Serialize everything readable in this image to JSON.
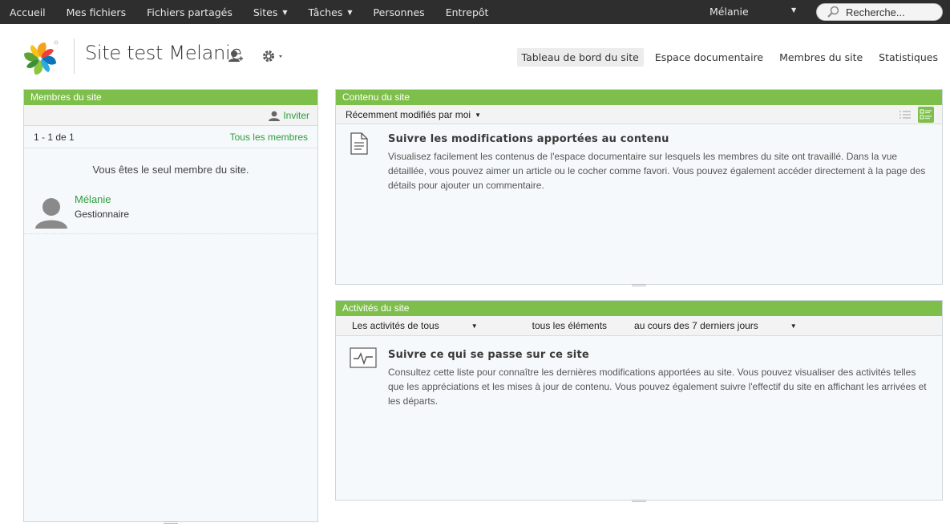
{
  "topnav": {
    "items": [
      {
        "label": "Accueil",
        "dropdown": false
      },
      {
        "label": "Mes fichiers",
        "dropdown": false
      },
      {
        "label": "Fichiers partagés",
        "dropdown": false
      },
      {
        "label": "Sites",
        "dropdown": true
      },
      {
        "label": "Tâches",
        "dropdown": true
      },
      {
        "label": "Personnes",
        "dropdown": false
      },
      {
        "label": "Entrepôt",
        "dropdown": false
      }
    ],
    "user": "Mélanie",
    "search_placeholder": "Recherche..."
  },
  "header": {
    "site_title": "Site test Melanie",
    "nav": [
      {
        "label": "Tableau de bord du site",
        "active": true
      },
      {
        "label": "Espace documentaire",
        "active": false
      },
      {
        "label": "Membres du site",
        "active": false
      },
      {
        "label": "Statistiques",
        "active": false
      }
    ]
  },
  "members_dashlet": {
    "title": "Membres du site",
    "invite": "Inviter",
    "count": "1 - 1 de 1",
    "all_members": "Tous les membres",
    "only_member": "Vous êtes le seul membre du site.",
    "members": [
      {
        "name": "Mélanie",
        "role": "Gestionnaire"
      }
    ]
  },
  "content_dashlet": {
    "title": "Contenu du site",
    "filter": "Récemment modifiés par moi",
    "help_title": "Suivre les modifications apportées au contenu",
    "help_text": "Visualisez facilement les contenus de l'espace documentaire sur lesquels les membres du site ont travaillé. Dans la vue détaillée, vous pouvez aimer un article ou le cocher comme favori. Vous pouvez également accéder directement à la page des détails pour ajouter un commentaire."
  },
  "activities_dashlet": {
    "title": "Activités du site",
    "filter_who": "Les activités de tous",
    "filter_what": "tous les éléments",
    "filter_when": "au cours des 7 derniers jours",
    "help_title": "Suivre ce qui se passe sur ce site",
    "help_text": "Consultez cette liste pour connaître les dernières modifications apportées au site. Vous pouvez visualiser des activités telles que les appréciations et les mises à jour de contenu. Vous pouvez également suivre l'effectif du site en affichant les arrivées et les départs."
  },
  "colors": {
    "topbar": "#2e2e2e",
    "dashlet_title": "#7ebf4b",
    "link_green": "#2d9c3c"
  }
}
